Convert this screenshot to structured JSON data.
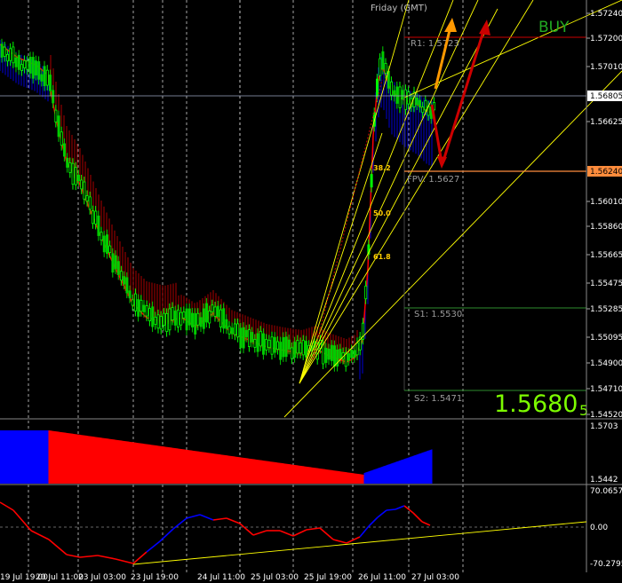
{
  "header": {
    "day": "Friday",
    "timezone": "(GMT)"
  },
  "signal": {
    "label": "BUY",
    "color": "#22aa22"
  },
  "current_price": {
    "main": "1.5680",
    "small": "5"
  },
  "levels": {
    "r1": {
      "name": "R1:",
      "value": "1.5723"
    },
    "fpv": {
      "name": "FPV:",
      "value": "1.5627"
    },
    "s1": {
      "name": "S1:",
      "value": "1.5530"
    },
    "s2": {
      "name": "S2:",
      "value": "1.5471"
    }
  },
  "fib_labels": [
    "38.2",
    "50.0",
    "61.8"
  ],
  "price_axis": [
    "1.57240",
    "1.57200",
    "1.57010",
    "1.56805",
    "1.56625",
    "1.56240",
    "1.56010",
    "1.55860",
    "1.55665",
    "1.55475",
    "1.55285",
    "1.55095",
    "1.54900",
    "1.54710",
    "1.54520"
  ],
  "price_highlight": {
    "bid": "1.56805",
    "fpv": "1.56240"
  },
  "osc1_axis": [
    "1.5703",
    "1.5442"
  ],
  "osc2_axis": [
    "70.0657",
    "0.00",
    "-70.2795"
  ],
  "time_axis": [
    "19 Jul 19:00",
    "20 Jul 11:00",
    "23 Jul 03:00",
    "23 Jul 19:00",
    "24 Jul 11:00",
    "25 Jul 03:00",
    "25 Jul 19:00",
    "26 Jul 11:00",
    "27 Jul 03:00"
  ],
  "colors": {
    "bull": "#00ff00",
    "bear": "#ff0000",
    "blue": "#0000ff",
    "grid": "#ffffff",
    "fib": "#ffff00",
    "orange_arrow": "#ff9900",
    "red_arrow": "#cc0000"
  }
}
